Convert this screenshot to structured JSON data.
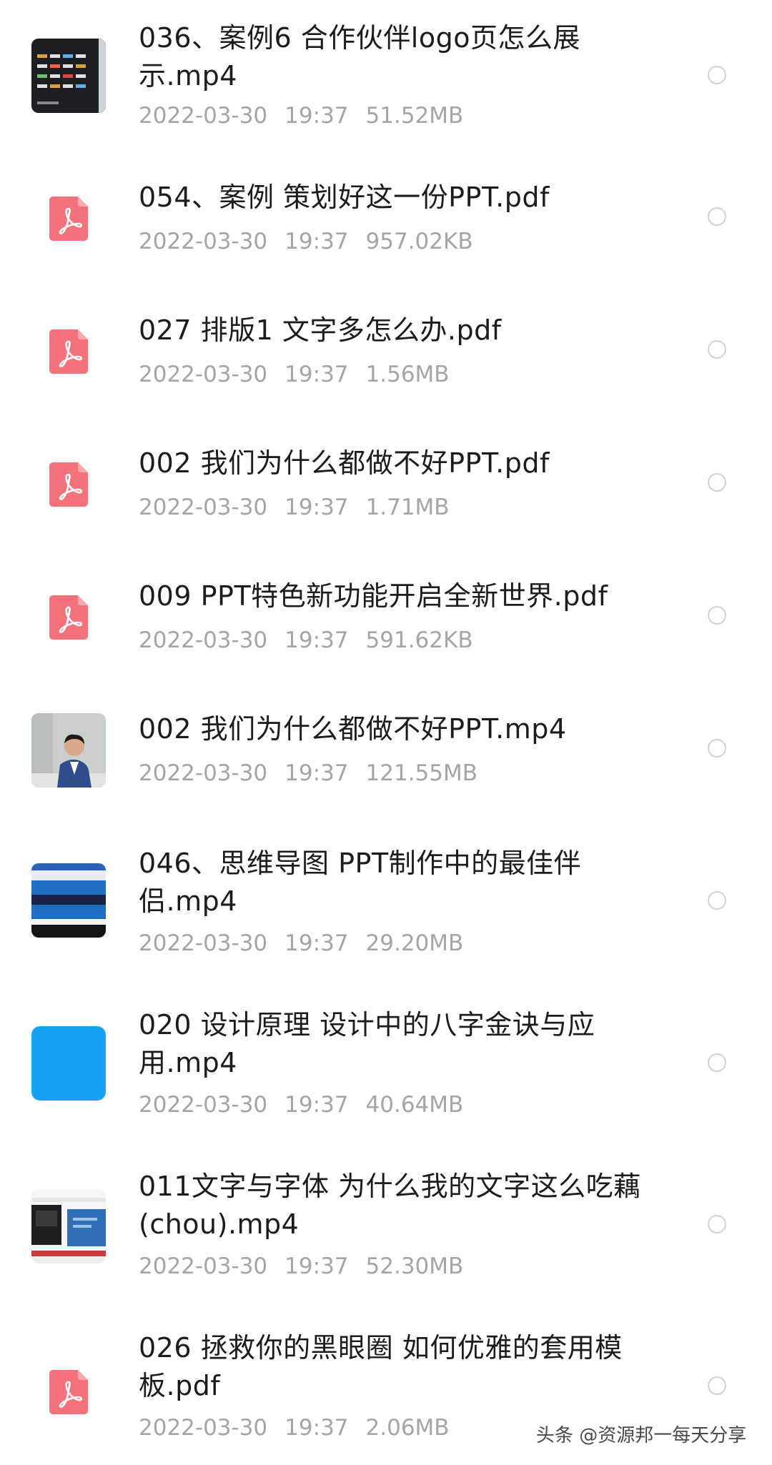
{
  "files": [
    {
      "name_line1": "036、案例6 合作伙伴logo页怎么展",
      "name_line2": "示.mp4",
      "date": "2022-03-30",
      "time": "19:37",
      "size": "51.52MB",
      "thumb": "logo-wall-thumbnail"
    },
    {
      "name_line1": "054、案例 策划好这一份PPT.pdf",
      "name_line2": "",
      "date": "2022-03-30",
      "time": "19:37",
      "size": "957.02KB",
      "thumb": "pdf-icon"
    },
    {
      "name_line1": "027 排版1 文字多怎么办.pdf",
      "name_line2": "",
      "date": "2022-03-30",
      "time": "19:37",
      "size": "1.56MB",
      "thumb": "pdf-icon"
    },
    {
      "name_line1": "002 我们为什么都做不好PPT.pdf",
      "name_line2": "",
      "date": "2022-03-30",
      "time": "19:37",
      "size": "1.71MB",
      "thumb": "pdf-icon"
    },
    {
      "name_line1": "009 PPT特色新功能开启全新世界.pdf",
      "name_line2": "",
      "date": "2022-03-30",
      "time": "19:37",
      "size": "591.62KB",
      "thumb": "pdf-icon"
    },
    {
      "name_line1": "002 我们为什么都做不好PPT.mp4",
      "name_line2": "",
      "date": "2022-03-30",
      "time": "19:37",
      "size": "121.55MB",
      "thumb": "presenter-video-thumbnail"
    },
    {
      "name_line1": "046、思维导图 PPT制作中的最佳伴",
      "name_line2": "侣.mp4",
      "date": "2022-03-30",
      "time": "19:37",
      "size": "29.20MB",
      "thumb": "slide-video-thumbnail"
    },
    {
      "name_line1": "020 设计原理 设计中的八字金诀与应",
      "name_line2": "用.mp4",
      "date": "2022-03-30",
      "time": "19:37",
      "size": "40.64MB",
      "thumb": "blue-video-thumbnail"
    },
    {
      "name_line1": "011文字与字体 为什么我的文字这么吃藕",
      "name_line2": "(chou).mp4",
      "date": "2022-03-30",
      "time": "19:37",
      "size": "52.30MB",
      "thumb": "screen-video-thumbnail"
    },
    {
      "name_line1": "026 拯救你的黑眼圈 如何优雅的套用模",
      "name_line2": "板.pdf",
      "date": "2022-03-30",
      "time": "19:37",
      "size": "2.06MB",
      "thumb": "pdf-icon"
    }
  ],
  "watermark": "头条 @资源邦一每天分享",
  "colors": {
    "pdf_icon": "#f4727a",
    "name_text": "#1c1c1c",
    "meta_text": "#a5a5a5",
    "select_circle": "#d2d2d2",
    "blue_thumb": "#17a3f2"
  }
}
